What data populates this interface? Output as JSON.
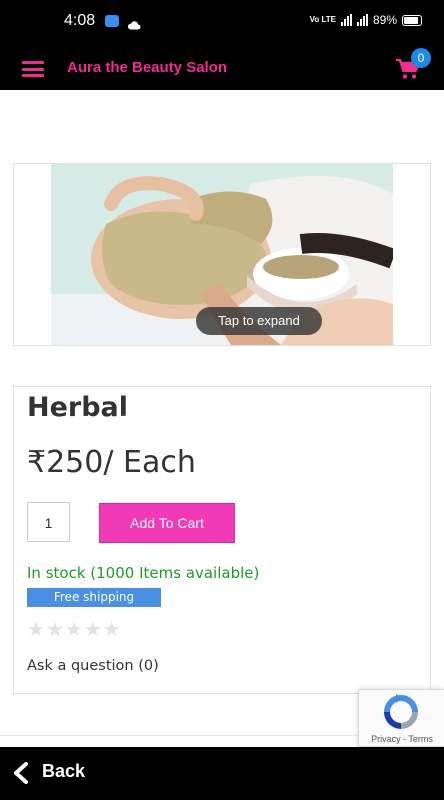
{
  "status_bar": {
    "time": "4:08",
    "network": "4G",
    "volte": "Vo LTE",
    "battery": "89%"
  },
  "header": {
    "title": "Aura the Beauty Salon",
    "cart_count": "0",
    "accent_color": "#e9308f"
  },
  "gallery": {
    "expand_label": "Tap to expand"
  },
  "product": {
    "name": "Herbal",
    "price": "₹250/ Each",
    "quantity": "1",
    "add_to_cart_label": "Add To Cart",
    "stock_text": "In stock (1000 Items available)",
    "shipping_badge": "Free shipping",
    "rating_stars": 0,
    "ask_question": "Ask a question (0)"
  },
  "recaptcha": {
    "links": "Privacy - Terms"
  },
  "bottom_bar": {
    "back_label": "Back"
  },
  "icons": [
    "menu-icon",
    "cart-icon",
    "back-arrow-icon",
    "recaptcha-icon"
  ]
}
